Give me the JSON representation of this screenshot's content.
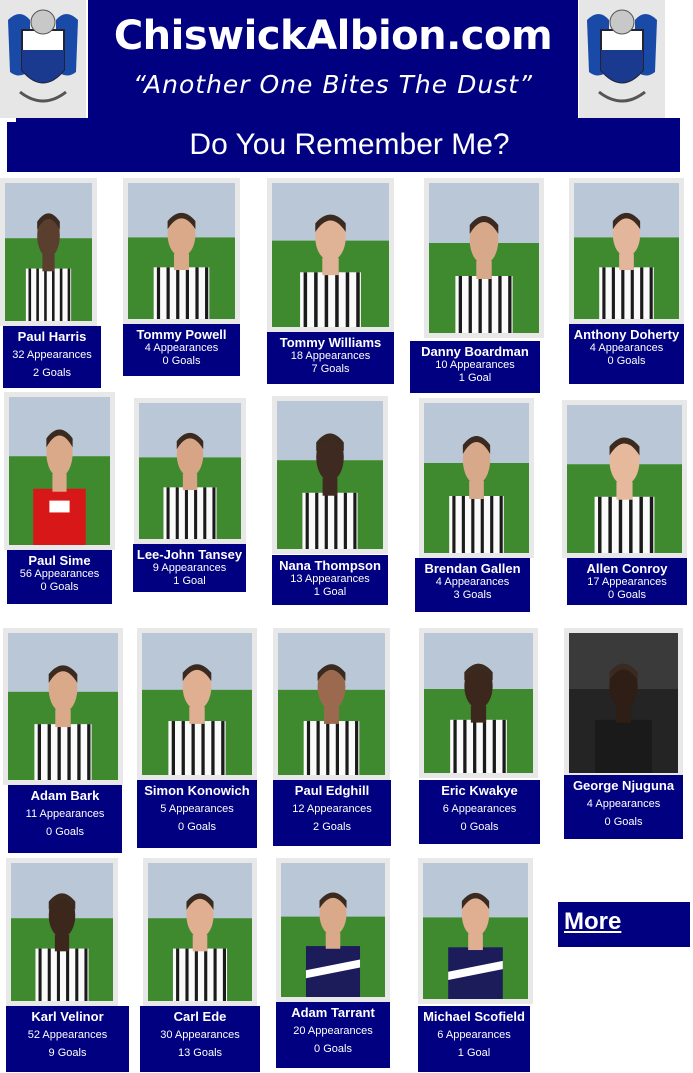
{
  "header": {
    "site_title": "ChiswickAlbion.com",
    "motto": "“Another One Bites The Dust”",
    "crest_icon": "club-crest-icon",
    "colors": {
      "navy": "#000080",
      "white": "#ffffff",
      "crest_grey": "#e6e6e6"
    }
  },
  "page": {
    "subtitle": "Do You Remember Me?"
  },
  "players": [
    {
      "name": "Paul Harris",
      "appearances": "32 Appearances",
      "goals": "2 Goals",
      "kit": "stripes",
      "skin": "#5a3e2e"
    },
    {
      "name": "Tommy Powell",
      "appearances": "4 Appearances",
      "goals": "0 Goals",
      "kit": "stripes",
      "skin": "#d9a98a"
    },
    {
      "name": "Tommy Williams",
      "appearances": "18 Appearances",
      "goals": "7 Goals",
      "kit": "stripes",
      "skin": "#e0b296"
    },
    {
      "name": "Danny Boardman",
      "appearances": "10 Appearances",
      "goals": "1 Goal",
      "kit": "stripes",
      "skin": "#d8a88a"
    },
    {
      "name": "Anthony Doherty",
      "appearances": "4 Appearances",
      "goals": "0 Goals",
      "kit": "stripes",
      "skin": "#e3b59a"
    },
    {
      "name": "Paul Sime",
      "appearances": "56 Appearances",
      "goals": "0 Goals",
      "kit": "red",
      "skin": "#d9a98a"
    },
    {
      "name": "Lee-John Tansey",
      "appearances": "9 Appearances",
      "goals": "1 Goal",
      "kit": "stripes",
      "skin": "#d7a585"
    },
    {
      "name": "Nana Thompson",
      "appearances": "13 Appearances",
      "goals": "1 Goal",
      "kit": "stripes",
      "skin": "#3e2a20"
    },
    {
      "name": "Brendan Gallen",
      "appearances": "4 Appearances",
      "goals": "3 Goals",
      "kit": "stripes",
      "skin": "#d8a88a"
    },
    {
      "name": "Allen Conroy",
      "appearances": "17 Appearances",
      "goals": "0 Goals",
      "kit": "stripes",
      "skin": "#e6b89c"
    },
    {
      "name": "Adam Bark",
      "appearances": "11 Appearances",
      "goals": "0 Goals",
      "kit": "stripes",
      "skin": "#d9a98a"
    },
    {
      "name": "Simon Konowich",
      "appearances": "5 Appearances",
      "goals": "0 Goals",
      "kit": "stripes",
      "skin": "#e0ae90"
    },
    {
      "name": "Paul Edghill",
      "appearances": "12 Appearances",
      "goals": "2 Goals",
      "kit": "stripes",
      "skin": "#9b6a4e"
    },
    {
      "name": "Eric Kwakye",
      "appearances": "6 Appearances",
      "goals": "0 Goals",
      "kit": "stripes",
      "skin": "#3b271c"
    },
    {
      "name": "George Njuguna",
      "appearances": "4 Appearances",
      "goals": "0 Goals",
      "kit": "dark",
      "skin": "#2e1e15"
    },
    {
      "name": "Karl Velinor",
      "appearances": "52 Appearances",
      "goals": "9 Goals",
      "kit": "stripes",
      "skin": "#3b271c"
    },
    {
      "name": "Carl Ede",
      "appearances": "30 Appearances",
      "goals": "13 Goals",
      "kit": "stripes",
      "skin": "#e0ae90"
    },
    {
      "name": "Adam Tarrant",
      "appearances": "20 Appearances",
      "goals": "0 Goals",
      "kit": "navy",
      "skin": "#d9a98a"
    },
    {
      "name": "Michael Scofield",
      "appearances": "6 Appearances",
      "goals": "1 Goal",
      "kit": "navy",
      "skin": "#e0ae90"
    }
  ],
  "more": {
    "label": "More"
  }
}
